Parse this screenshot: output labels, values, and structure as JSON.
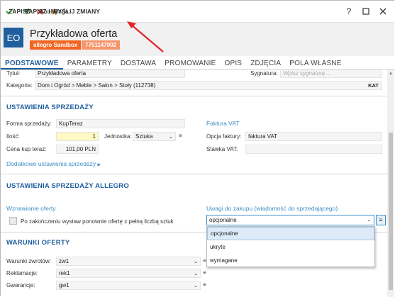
{
  "toolbar": {
    "save": "ZAPISZ",
    "save_send": "ZAPISZ I WYŚLIJ ZMIANY",
    "cancel": "Anuluj",
    "flag": "Flaga",
    "help": "?",
    "colors": {
      "green": "#3a9a3a",
      "red": "#d9261c",
      "star": "#f2a81d"
    }
  },
  "header": {
    "avatar": "EO",
    "title": "Przykładowa oferta",
    "badge_env": "allegro Sandbox",
    "badge_id": "7751147002"
  },
  "tabs": [
    "PODSTAWOWE",
    "PARAMETRY",
    "DOSTAWA",
    "PROMOWANIE",
    "OPIS",
    "ZDJĘCIA",
    "POLA WŁASNE"
  ],
  "top": {
    "title_label": "Tytuł:",
    "title_value": "Przykładowa oferta",
    "signature_label": "Sygnatura:",
    "signature_placeholder": "Wpisz sygnaturę...",
    "category_label": "Kategoria:",
    "category_value": "Dom i Ogród > Meble > Salon > Stoły (112738)",
    "kat": "KAT"
  },
  "sales": {
    "heading": "USTAWIENIA SPRZEDAŻY",
    "form_label": "Forma sprzedaży:",
    "form_value": "KupTeraz",
    "qty_label": "Ilość:",
    "qty_value": "1",
    "unit_label": "Jednostka:",
    "unit_value": "Sztuka",
    "price_label": "Cena kup teraz:",
    "price_value": "101,00 PLN",
    "vat_heading": "Faktura VAT",
    "invoice_label": "Opcja faktury:",
    "invoice_value": "faktura VAT",
    "vat_rate_label": "Stawka VAT:",
    "vat_rate_value": "",
    "more_link": "Dodatkowe ustawienia sprzedaży"
  },
  "allegro": {
    "heading": "USTAWIENIA SPRZEDAŻY ALLEGRO",
    "resume_heading": "Wznawianie oferty",
    "resume_checkbox": "Po zakończeniu wystaw ponownie ofertę z pełną liczbą sztuk",
    "notes_heading": "Uwagi do zakupu (wiadomość do sprzedającego)",
    "notes_value": "opcjonalne",
    "notes_options": [
      "opcjonalne",
      "ukryte",
      "wymagane"
    ]
  },
  "terms": {
    "heading": "WARUNKI OFERTY",
    "returns_label": "Warunki zwrotów:",
    "returns_value": "zw1",
    "complaints_label": "Reklamacje:",
    "complaints_value": "rek1",
    "warranty_label": "Gwarancje:",
    "warranty_value": "gw1"
  },
  "colors": {
    "accent": "#1f5f9e",
    "orange": "#f26522",
    "link": "#3d8fc6",
    "arrow": "#e3242b"
  }
}
